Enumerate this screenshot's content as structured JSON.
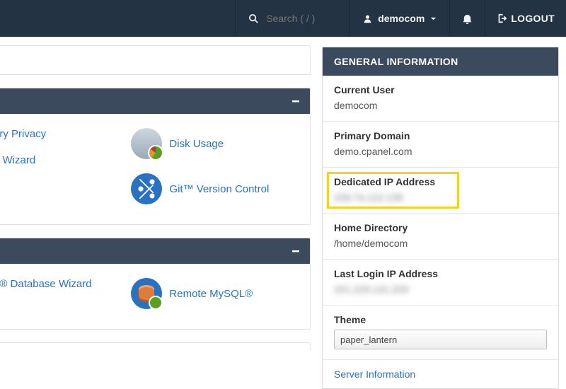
{
  "topnav": {
    "search_placeholder": "Search ( / )",
    "username": "democom",
    "logout": "LOGOUT"
  },
  "files_panel": {
    "privacy_label": "ory Privacy",
    "disk_usage_label": "Disk Usage",
    "wizard_label": "p Wizard",
    "git_label": "Git™ Version Control"
  },
  "db_panel": {
    "db_wizard_label": "L® Database Wizard",
    "remote_mysql_label": "Remote MySQL®"
  },
  "sidebar": {
    "header": "GENERAL INFORMATION",
    "current_user_label": "Current User",
    "current_user_value": "democom",
    "primary_domain_label": "Primary Domain",
    "primary_domain_value": "demo.cpanel.com",
    "dedicated_ip_label": "Dedicated IP Address",
    "dedicated_ip_value": "208.74.122.138",
    "home_dir_label": "Home Directory",
    "home_dir_value": "/home/democom",
    "last_login_label": "Last Login IP Address",
    "last_login_value": "201.229.141.209",
    "theme_label": "Theme",
    "theme_value": "paper_lantern",
    "server_info_label": "Server Information"
  }
}
